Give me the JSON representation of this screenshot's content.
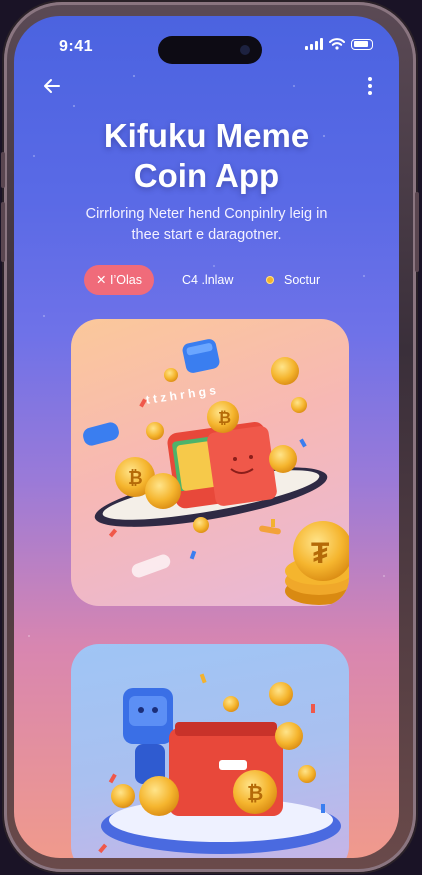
{
  "status": {
    "time": "9:41"
  },
  "header": {
    "title_line1": "Kifuku Meme",
    "title_line2": "Coin App",
    "subtitle_line1": "Cirrloring Neter hend Conpinlry leig in",
    "subtitle_line2": "thee start e daragotner."
  },
  "chips": [
    {
      "label": "✕ I’Olas",
      "active": true
    },
    {
      "label": "C4 .lnlaw",
      "active": false
    },
    {
      "label": "Soctur",
      "active": false
    }
  ],
  "cards": [
    {
      "arc_text": "t t z h r h g s",
      "illustration": "coin-wallet-ufo-illustration"
    },
    {
      "illustration": "robot-wallet-coins-illustration"
    }
  ],
  "colors": {
    "bg_top": "#4b63e0",
    "bg_bottom": "#f09a8c",
    "chip_active": "#f06b7a",
    "coin": "#f3b22e",
    "wallet": "#e8483a"
  }
}
